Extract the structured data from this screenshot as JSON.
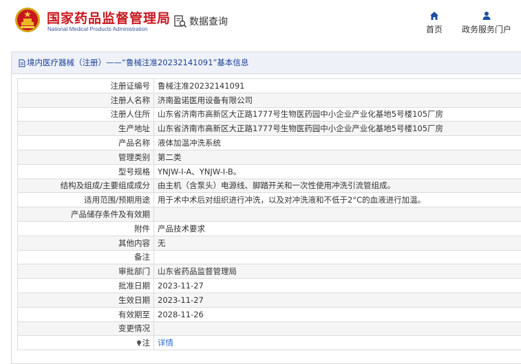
{
  "header": {
    "brand_cn": "国家药品监督管理局",
    "brand_en": "National Medical Products Administration",
    "db_query": "数据查询",
    "nav": [
      {
        "label": "首页",
        "icon": "home-icon"
      },
      {
        "label": "政务服务门户",
        "icon": "user-icon"
      }
    ]
  },
  "breadcrumb": "境内医疗器械（注册）——“鲁械注准20232141091”基本信息",
  "rows": [
    {
      "key": "注册证编号",
      "value": "鲁械注准20232141091"
    },
    {
      "key": "注册人名称",
      "value": "济南盈诺医用设备有限公司"
    },
    {
      "key": "注册人住所",
      "value": "山东省济南市高新区大正路1777号生物医药园中小企业产业化基地5号楼105厂房"
    },
    {
      "key": "生产地址",
      "value": "山东省济南市高新区大正路1777号生物医药园中小企业产业化基地5号楼105厂房"
    },
    {
      "key": "产品名称",
      "value": "液体加温冲洗系统"
    },
    {
      "key": "管理类别",
      "value": "第二类"
    },
    {
      "key": "型号规格",
      "value": "YNJW-I-A、YNJW-I-B。"
    },
    {
      "key": "结构及组成/主要组成成分",
      "value": "由主机（含泵头）电源线、脚踏开关和一次性使用冲洗引流管组成。"
    },
    {
      "key": "适用范围/预期用途",
      "value": "用于术中术后对组织进行冲洗，以及对冲洗液和不低于2°C的血液进行加温。"
    },
    {
      "key": "产品储存条件及有效期",
      "value": ""
    },
    {
      "key": "附件",
      "value": "产品技术要求"
    },
    {
      "key": "其他内容",
      "value": "无"
    },
    {
      "key": "备注",
      "value": ""
    },
    {
      "key": "审批部门",
      "value": "山东省药品监督管理局"
    },
    {
      "key": "批准日期",
      "value": "2023-11-27"
    },
    {
      "key": "生效日期",
      "value": "2023-11-27"
    },
    {
      "key": "有效期至",
      "value": "2028-11-26"
    },
    {
      "key": "变更情况",
      "value": ""
    }
  ],
  "note_row": {
    "key": "注",
    "link": "详情",
    "icon": "lightbulb-icon"
  },
  "colors": {
    "brand_red": "#c8161d",
    "brand_blue": "#3a5a9c",
    "nav_blue": "#1c4fa0",
    "crumb_bg": "#eef2f8",
    "crumb_text": "#1c3f94",
    "link": "#2a6dcc"
  }
}
